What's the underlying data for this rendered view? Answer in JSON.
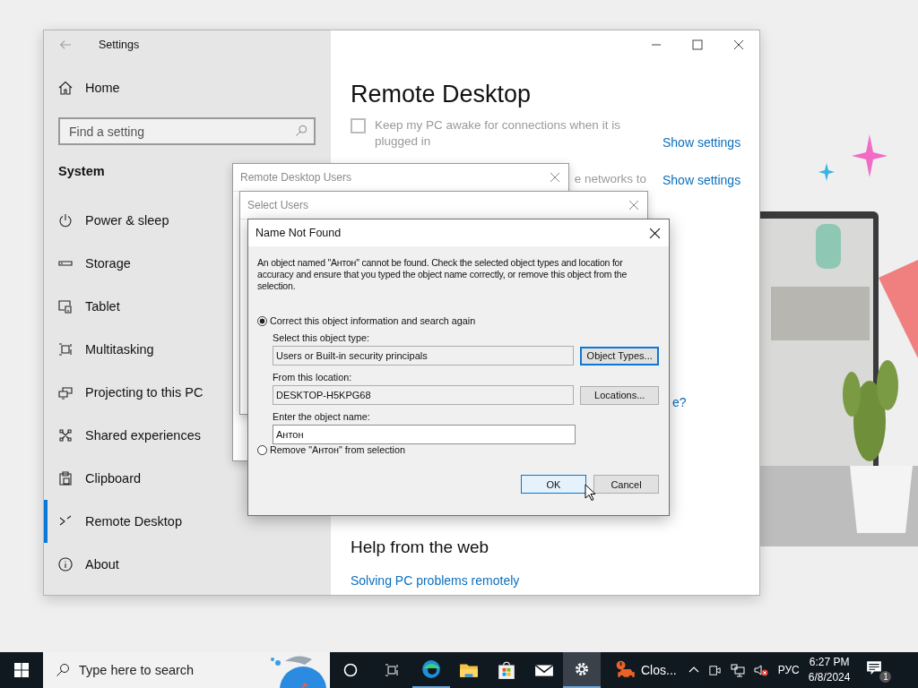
{
  "settings_window": {
    "title": "Settings",
    "sidebar": {
      "home": "Home",
      "search": {
        "placeholder": "Find a setting"
      },
      "section": "System",
      "items": [
        {
          "label": "Power & sleep",
          "selected": false
        },
        {
          "label": "Storage",
          "selected": false
        },
        {
          "label": "Tablet",
          "selected": false
        },
        {
          "label": "Multitasking",
          "selected": false
        },
        {
          "label": "Projecting to this PC",
          "selected": false
        },
        {
          "label": "Shared experiences",
          "selected": false
        },
        {
          "label": "Clipboard",
          "selected": false
        },
        {
          "label": "Remote Desktop",
          "selected": true
        },
        {
          "label": "About",
          "selected": false
        }
      ]
    },
    "page": {
      "heading": "Remote Desktop",
      "options": [
        {
          "kind": "checkbox",
          "label": "Keep my PC awake for connections when it is plugged in",
          "checked": false,
          "link": "Show settings"
        },
        {
          "kind": "text",
          "label": "e networks to",
          "link": "Show settings"
        }
      ],
      "link_fragment": "e?",
      "help_heading": "Help from the web",
      "help_links": [
        "Solving PC problems remotely"
      ]
    }
  },
  "background_dialogs": [
    {
      "title": "Remote Desktop Users",
      "active": false
    },
    {
      "title": "Select Users",
      "active": false
    }
  ],
  "name_not_found": {
    "title": "Name Not Found",
    "message": "An object named \"Антон\" cannot be found. Check the selected object types and location for accuracy and ensure that you typed the object name correctly, or remove this object from the selection.",
    "choices": [
      {
        "label": "Correct this object information and search again",
        "selected": true
      },
      {
        "label": "Remove \"Антон\" from selection",
        "selected": false
      }
    ],
    "fields": [
      {
        "label": "Select this object type:",
        "value": "Users or Built-in security principals",
        "editable": false,
        "button": "Object Types...",
        "button_focused": true
      },
      {
        "label": "From this location:",
        "value": "DESKTOP-H5KPG68",
        "editable": false,
        "button": "Locations...",
        "button_focused": false
      },
      {
        "label": "Enter the object name:",
        "value": "Антон",
        "editable": true
      }
    ],
    "buttons": [
      {
        "label": "OK",
        "default": true
      },
      {
        "label": "Cancel",
        "default": false
      }
    ]
  },
  "taskbar": {
    "search_placeholder": "Type here to search",
    "apps": [
      {
        "running": true,
        "selected": false
      },
      {
        "running": false,
        "selected": false
      },
      {
        "running": false,
        "selected": false
      },
      {
        "running": false,
        "selected": false
      },
      {
        "running": true,
        "selected": true
      }
    ],
    "task_button": "Clos...",
    "language": "РУС",
    "time": "6:27 PM",
    "date": "6/8/2024",
    "notification_count": "1"
  }
}
